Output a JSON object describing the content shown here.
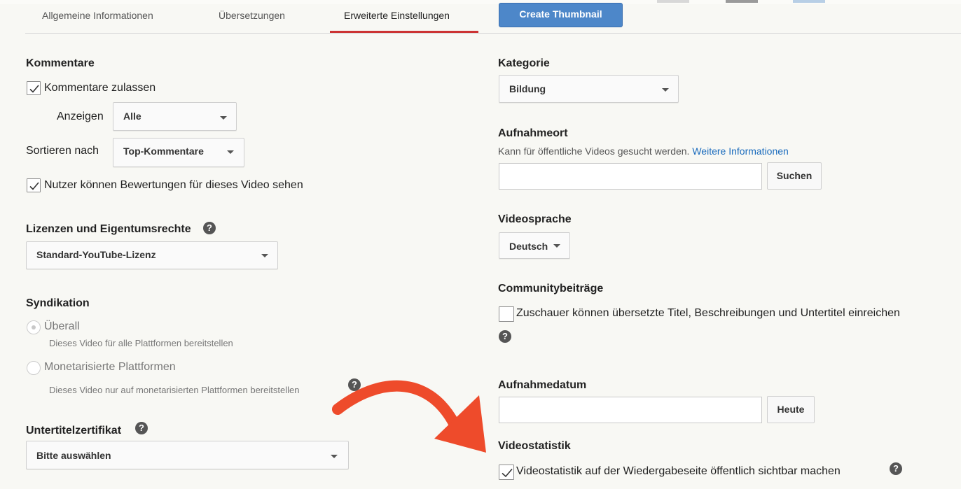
{
  "tabs": [
    {
      "label": "Allgemeine Informationen"
    },
    {
      "label": "Übersetzungen"
    },
    {
      "label": "Erweiterte Einstellungen"
    }
  ],
  "create_thumbnail_label": "Create Thumbnail",
  "left": {
    "comments": {
      "title": "Kommentare",
      "allow_label": "Kommentare zulassen",
      "allow_checked": true,
      "show_label": "Anzeigen",
      "show_value": "Alle",
      "sort_label": "Sortieren nach",
      "sort_value": "Top-Kommentare",
      "ratings_label": "Nutzer können Bewertungen für dieses Video sehen",
      "ratings_checked": true
    },
    "license": {
      "title": "Lizenzen und Eigentumsrechte",
      "value": "Standard-YouTube-Lizenz"
    },
    "syndication": {
      "title": "Syndikation",
      "option1_label": "Überall",
      "option1_desc": "Dieses Video für alle Plattformen bereitstellen",
      "option1_selected": true,
      "option2_label": "Monetarisierte Plattformen",
      "option2_desc": "Dieses Video nur auf monetarisierten Plattformen bereitstellen"
    },
    "caption_cert": {
      "title": "Untertitelzertifikat",
      "value": "Bitte auswählen"
    }
  },
  "right": {
    "category": {
      "title": "Kategorie",
      "value": "Bildung"
    },
    "location": {
      "title": "Aufnahmeort",
      "desc": "Kann für öffentliche Videos gesucht werden.",
      "link": "Weitere Informationen",
      "input_value": "",
      "button": "Suchen"
    },
    "language": {
      "title": "Videosprache",
      "value": "Deutsch"
    },
    "community": {
      "title": "Communitybeiträge",
      "label": "Zuschauer können übersetzte Titel, Beschreibungen und Untertitel einreichen",
      "checked": false
    },
    "recording_date": {
      "title": "Aufnahmedatum",
      "input_value": "",
      "button": "Heute"
    },
    "stats": {
      "title": "Videostatistik",
      "label": "Videostatistik auf der Wiedergabeseite öffentlich sichtbar machen",
      "checked": true
    }
  },
  "help_glyph": "?",
  "colors": {
    "arrow": "#ee4b2b",
    "tab_active": "#cc3333",
    "button_blue": "#4d87c9",
    "link": "#1a6bbd"
  },
  "icons": {
    "help": "help-icon",
    "check": "checkmark-icon",
    "caret": "caret-down-icon",
    "arrow": "curved-arrow-annotation"
  }
}
